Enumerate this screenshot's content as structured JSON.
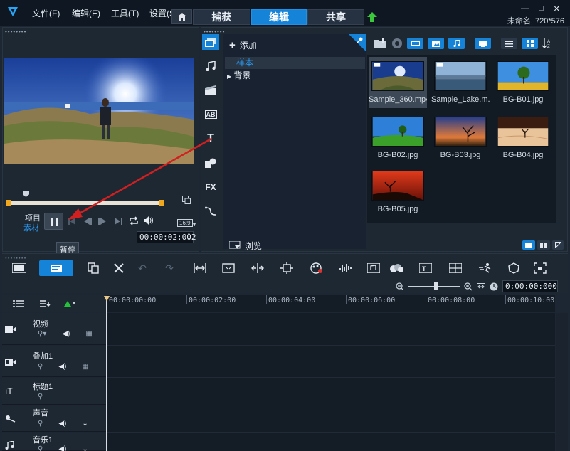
{
  "menu": [
    "文件(F)",
    "编辑(E)",
    "工具(T)",
    "设置(S)"
  ],
  "main_tabs": {
    "capture": "捕获",
    "edit": "编辑",
    "share": "共享"
  },
  "window": {
    "minimize": "—",
    "maximize": "□",
    "close": "✕",
    "project_info": "未命名, 720*576"
  },
  "player": {
    "mode_project": "项目",
    "mode_clip": "素材",
    "timecode": "00:00:02:002",
    "aspect": "16:9",
    "tooltip": "暂停"
  },
  "library": {
    "add_label": "添加",
    "folders": [
      "样本",
      "背景"
    ],
    "browse_label": "浏览",
    "thumbnails": [
      {
        "name": "Sample_360.mp4",
        "selected": true
      },
      {
        "name": "Sample_Lake.m...",
        "selected": false
      },
      {
        "name": "BG-B01.jpg",
        "selected": false
      },
      {
        "name": "BG-B02.jpg",
        "selected": false
      },
      {
        "name": "BG-B03.jpg",
        "selected": false
      },
      {
        "name": "BG-B04.jpg",
        "selected": false
      },
      {
        "name": "BG-B05.jpg",
        "selected": false
      }
    ]
  },
  "side_icons": [
    "media-icon",
    "audio-icon",
    "instant-project-icon",
    "transition-icon",
    "title-icon",
    "graphics-icon",
    "fx-icon",
    "path-icon"
  ],
  "side_text": {
    "transition": "AB",
    "title": "T",
    "fx": "FX"
  },
  "timeline": {
    "time": "0:00:00:000",
    "ruler": [
      "00:00:00:00",
      "00:00:02:00",
      "00:00:04:00",
      "00:00:06:00",
      "00:00:08:00",
      "00:00:10:00"
    ],
    "tracks": [
      {
        "name": "视频",
        "icon": "video-track-icon"
      },
      {
        "name": "叠加1",
        "icon": "overlay-track-icon"
      },
      {
        "name": "标题1",
        "icon": "title-track-icon"
      },
      {
        "name": "声音",
        "icon": "voice-track-icon"
      },
      {
        "name": "音乐1",
        "icon": "music-track-icon"
      }
    ]
  },
  "colors": {
    "accent": "#1584d8",
    "annotation_arrow": "#d21f1f",
    "trim_marker": "#f0a91e"
  }
}
